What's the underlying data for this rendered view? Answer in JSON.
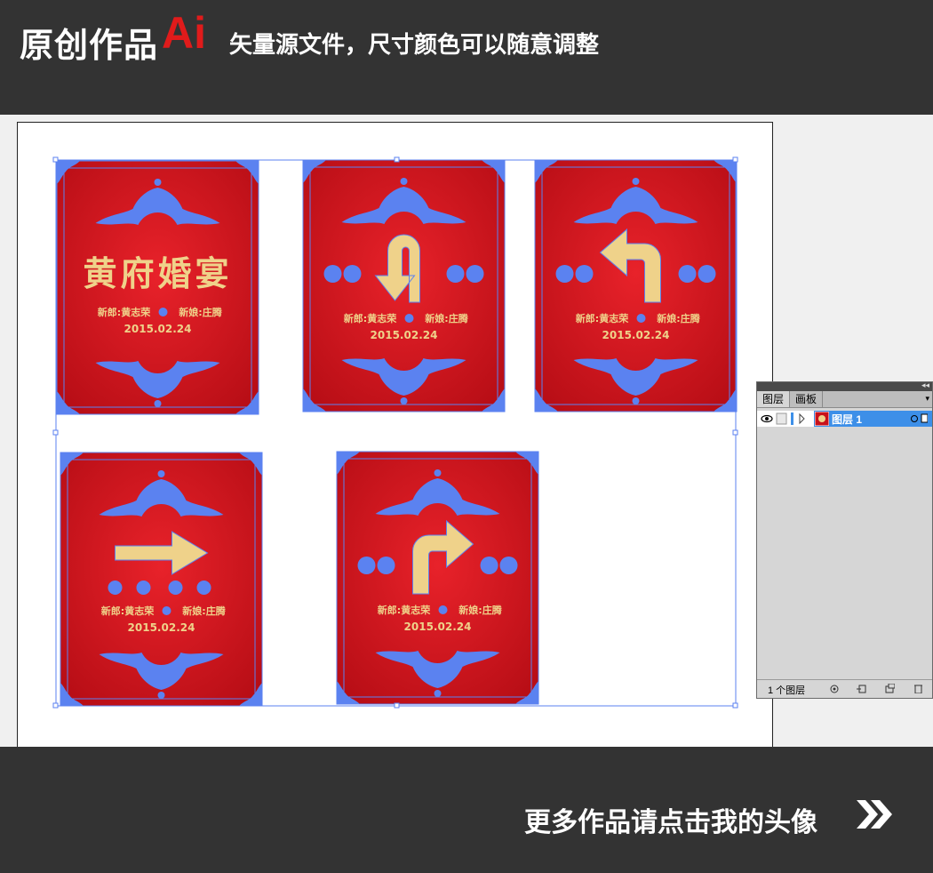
{
  "header": {
    "brand": "原创作品",
    "ai_logo": "Ai",
    "subtitle": "矢量源文件，尺寸颜色可以随意调整",
    "bg_color": "#333333",
    "ai_color": "#e01b1b"
  },
  "signs": [
    {
      "type": "title",
      "title": "黄府婚宴",
      "names": "新郎:黄志荣",
      "names2": "新娘:庄腾",
      "date": "2015.02.24"
    },
    {
      "type": "u-turn-arrow",
      "names": "新郎:黄志荣",
      "names2": "新娘:庄腾",
      "date": "2015.02.24"
    },
    {
      "type": "left-turn-arrow",
      "names": "新郎:黄志荣",
      "names2": "新娘:庄腾",
      "date": "2015.02.24"
    },
    {
      "type": "right-arrow",
      "names": "新郎:黄志荣",
      "names2": "新娘:庄腾",
      "date": "2015.02.24"
    },
    {
      "type": "right-turn-arrow",
      "names": "新郎:黄志荣",
      "names2": "新娘:庄腾",
      "date": "2015.02.24"
    }
  ],
  "sign_colors": {
    "red": "#c8111b",
    "ornament": "#5b82f0",
    "gold": "#efd28a"
  },
  "layers_panel": {
    "tabs": [
      "图层",
      "画板"
    ],
    "active_tab": "图层",
    "layer_name": "图层 1",
    "layer_count": "1 个图层",
    "selection_color": "#3d8fe8"
  },
  "footer": {
    "text": "更多作品请点击我的头像",
    "icon": "double-chevron-right-icon"
  }
}
